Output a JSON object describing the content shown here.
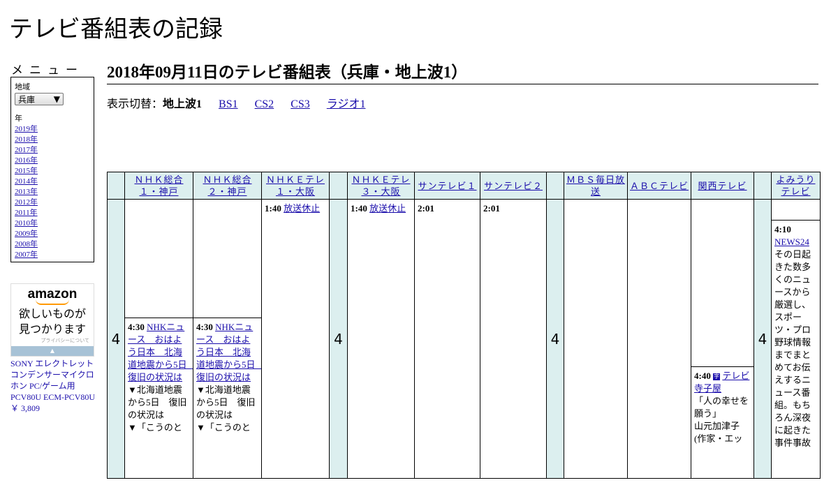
{
  "site_title": "テレビ番組表の記録",
  "menu": {
    "heading": "メニュー",
    "region_label": "地域",
    "region_value": "兵庫",
    "year_label": "年",
    "years": [
      "2019年",
      "2018年",
      "2017年",
      "2016年",
      "2015年",
      "2014年",
      "2013年",
      "2012年",
      "2011年",
      "2010年",
      "2009年",
      "2008年",
      "2007年"
    ]
  },
  "ad": {
    "brand": "amazon",
    "line1": "欲しいものが",
    "line2": "見つかります",
    "privacy": "プライバシーについて",
    "product": "SONY エレクトレットコンデンサーマイクロホン PC/ゲーム用 PCV80U ECM-PCV80U",
    "price": "￥ 3,809"
  },
  "page_title": "2018年09月11日のテレビ番組表（兵庫・地上波1）",
  "switcher": {
    "label": "表示切替：",
    "current": "地上波1",
    "links": [
      "BS1",
      "CS2",
      "CS3",
      "ラジオ1"
    ]
  },
  "hour": "4",
  "channels": [
    "ＮＨＫ総合１・神戸",
    "ＮＨＫ総合２・神戸",
    "ＮＨＫＥテレ１・大阪",
    "ＮＨＫＥテレ３・大阪",
    "サンテレビ１",
    "サンテレビ２",
    "ＭＢＳ毎日放送",
    "ＡＢＣテレビ",
    "関西テレビ",
    "よみうりテレビ"
  ],
  "programs": {
    "nhk1": {
      "time": "4:30",
      "title": "NHKニュース　おはよう日本　北海道地震から5日　復旧の状況は",
      "desc": "▼北海道地震から5日　復旧の状況は\n▼「こうのと"
    },
    "nhk2": {
      "time": "4:30",
      "title": "NHKニュース　おはよう日本　北海道地震から5日　復旧の状況は",
      "desc": "▼北海道地震から5日　復旧の状況は\n▼「こうのと"
    },
    "etv1": {
      "time": "1:40",
      "title": "放送休止"
    },
    "etv3": {
      "time": "1:40",
      "title": "放送休止"
    },
    "sun1": {
      "time": "2:01"
    },
    "sun2": {
      "time": "2:01"
    },
    "ktv": {
      "time": "4:40",
      "title": "テレビ寺子屋",
      "desc": "「人の幸せを願う」\n山元加津子(作家・エッ"
    },
    "ytv": {
      "time": "4:10",
      "title": "NEWS24",
      "desc": "その日起きた数多くのニュースから厳選し、スポーツ・プロ野球情報までまとめてお伝えするニュース番組。もちろん深夜に起きた事件事故"
    }
  }
}
